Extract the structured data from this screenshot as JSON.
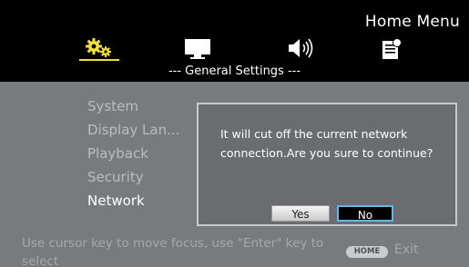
{
  "header": {
    "title": "Home Menu",
    "categories": [
      {
        "icon": "settings-gears-icon",
        "selected": true,
        "color": "#f3df3a"
      },
      {
        "icon": "display-monitor-icon",
        "selected": false,
        "color": "#ffffff"
      },
      {
        "icon": "speaker-sound-icon",
        "selected": false,
        "color": "#ffffff"
      },
      {
        "icon": "document-info-icon",
        "selected": false,
        "color": "#ffffff"
      }
    ]
  },
  "section_title": "--- General Settings ---",
  "menu": {
    "items": [
      {
        "label": "System",
        "active": false
      },
      {
        "label": "Display Lan...",
        "active": false
      },
      {
        "label": "Playback",
        "active": false
      },
      {
        "label": "Security",
        "active": false
      },
      {
        "label": "Network",
        "active": true
      }
    ]
  },
  "dialog": {
    "message": "It will cut off the current network connection.Are you sure to continue?",
    "yes_label": "Yes",
    "no_label": "No",
    "focused_button": "No"
  },
  "footer": {
    "hint": "Use cursor key to move focus, use \"Enter\" key to select",
    "home_key_label": "HOME",
    "exit_label": "Exit"
  },
  "colors": {
    "selected_accent": "#f3df3a",
    "focus_border": "#5fb9e8",
    "background": "#777b7e",
    "topbar": "#000000"
  }
}
